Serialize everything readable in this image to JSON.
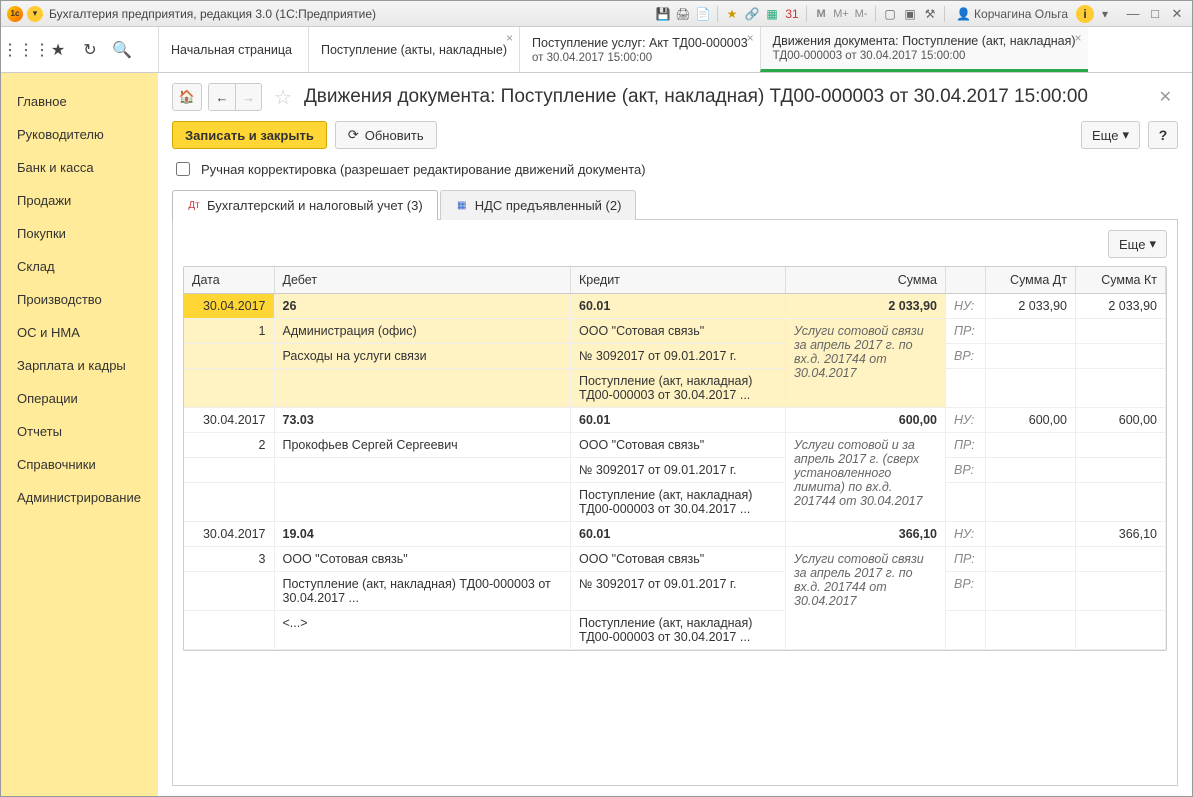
{
  "titlebar": {
    "title": "Бухгалтерия предприятия, редакция 3.0  (1С:Предприятие)",
    "user": "Корчагина Ольга",
    "m": "M",
    "mplus": "M+",
    "mminus": "M-"
  },
  "topTabs": [
    {
      "label": "Начальная страница",
      "sub": "",
      "closable": false,
      "active": false
    },
    {
      "label": "Поступление (акты, накладные)",
      "sub": "",
      "closable": true,
      "active": false
    },
    {
      "label": "Поступление услуг: Акт ТД00-000003",
      "sub": "от 30.04.2017 15:00:00",
      "closable": true,
      "active": false
    },
    {
      "label": "Движения документа: Поступление (акт, накладная)",
      "sub": "ТД00-000003 от 30.04.2017 15:00:00",
      "closable": true,
      "active": true
    }
  ],
  "sidebar": {
    "items": [
      "Главное",
      "Руководителю",
      "Банк и касса",
      "Продажи",
      "Покупки",
      "Склад",
      "Производство",
      "ОС и НМА",
      "Зарплата и кадры",
      "Операции",
      "Отчеты",
      "Справочники",
      "Администрирование"
    ]
  },
  "header": {
    "title": "Движения документа: Поступление (акт, накладная) ТД00-000003 от 30.04.2017 15:00:00"
  },
  "actions": {
    "save": "Записать и закрыть",
    "refresh": "Обновить",
    "more": "Еще",
    "help": "?"
  },
  "checkbox": {
    "label": "Ручная корректировка (разрешает редактирование движений документа)"
  },
  "innerTabs": [
    {
      "label": "Бухгалтерский и налоговый учет (3)",
      "active": true
    },
    {
      "label": "НДС предъявленный (2)",
      "active": false
    }
  ],
  "moreInner": "Еще",
  "columns": {
    "date": "Дата",
    "debit": "Дебет",
    "credit": "Кредит",
    "sum": "Сумма",
    "sumDt": "Сумма Дт",
    "sumKt": "Сумма Кт"
  },
  "tags": {
    "nu": "НУ:",
    "pr": "ПР:",
    "vr": "ВР:"
  },
  "rows": [
    {
      "highlight": true,
      "date": "30.04.2017",
      "n": "1",
      "debitAcc": "26",
      "debitLines": [
        "Администрация (офис)",
        "Расходы на услуги связи"
      ],
      "creditAcc": "60.01",
      "creditLines": [
        "ООО \"Сотовая связь\"",
        "№ 3092017 от 09.01.2017 г.",
        "Поступление (акт, накладная) ТД00-000003 от 30.04.2017 ..."
      ],
      "sum": "2 033,90",
      "desc": "Услуги сотовой связи за апрель 2017 г. по вх.д. 201744 от 30.04.2017",
      "sumDt": "2 033,90",
      "sumKt": "2 033,90"
    },
    {
      "highlight": false,
      "date": "30.04.2017",
      "n": "2",
      "debitAcc": "73.03",
      "debitLines": [
        "Прокофьев Сергей Сергеевич"
      ],
      "creditAcc": "60.01",
      "creditLines": [
        "ООО \"Сотовая связь\"",
        "№ 3092017 от 09.01.2017 г.",
        "Поступление (акт, накладная) ТД00-000003 от 30.04.2017 ..."
      ],
      "sum": "600,00",
      "desc": "Услуги сотовой и за апрель 2017 г. (сверх установленного лимита) по вх.д. 201744 от 30.04.2017",
      "sumDt": "600,00",
      "sumKt": "600,00"
    },
    {
      "highlight": false,
      "date": "30.04.2017",
      "n": "3",
      "debitAcc": "19.04",
      "debitLines": [
        "ООО \"Сотовая связь\"",
        "Поступление (акт, накладная) ТД00-000003 от 30.04.2017 ...",
        "<...>"
      ],
      "creditAcc": "60.01",
      "creditLines": [
        "ООО \"Сотовая связь\"",
        "№ 3092017 от 09.01.2017 г.",
        "Поступление (акт, накладная) ТД00-000003 от 30.04.2017 ..."
      ],
      "sum": "366,10",
      "desc": "Услуги сотовой связи за апрель 2017 г. по вх.д. 201744 от 30.04.2017",
      "sumDt": "",
      "sumKt": "366,10"
    }
  ]
}
